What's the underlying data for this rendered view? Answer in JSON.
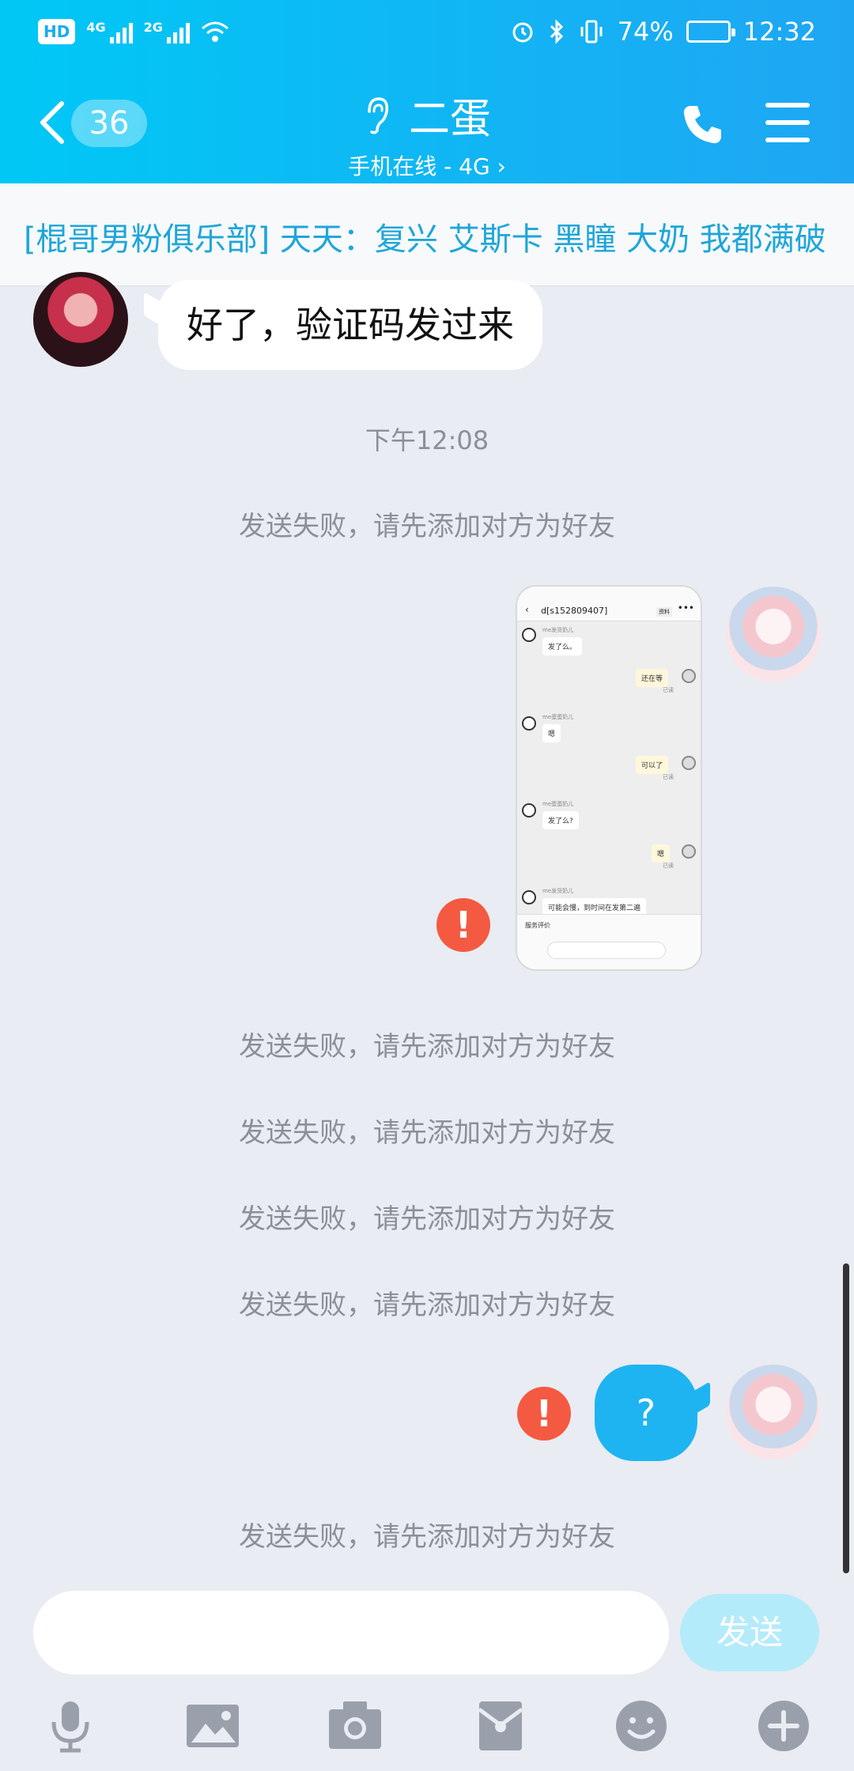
{
  "status_bar": {
    "hd": "HD",
    "sim1_network": "4G",
    "sim2_network": "2G",
    "battery_percent": "74%",
    "battery_level": 0.74,
    "time": "12:32"
  },
  "header": {
    "unread_count": "36",
    "contact_name": "二蛋",
    "status": "手机在线 - 4G",
    "bg_colors": [
      "#00c8f5",
      "#1fa6f3"
    ]
  },
  "ticker": {
    "text": "[棍哥男粉俱乐部] 天天：复兴 艾斯卡 黑瞳 大奶 我都满破"
  },
  "messages": {
    "incoming_text": "好了，验证码发过来",
    "timestamp": "下午12:08",
    "system_notice": "发送失败，请先添加对方为好友",
    "error_mark": "!",
    "outgoing_text": "?"
  },
  "screenshot_thumb": {
    "title": "d[s152809407]",
    "tag": "资料",
    "rows": [
      {
        "sender": "me发货奶儿",
        "text": "发了么。",
        "side": "left"
      },
      {
        "sender": "",
        "text": "还在等",
        "side": "right",
        "note": "已读"
      },
      {
        "sender": "me蛋蛋奶儿",
        "text": "嗯",
        "side": "left"
      },
      {
        "sender": "",
        "text": "可以了",
        "side": "right",
        "note": "已读"
      },
      {
        "sender": "me蛋蛋奶儿",
        "text": "发了么?",
        "side": "left"
      },
      {
        "sender": "",
        "text": "嗯",
        "side": "right",
        "note": "已读"
      },
      {
        "sender": "me发货奶儿",
        "text": "可能会慢，到时间在发第二遍",
        "side": "left"
      }
    ],
    "footer_label": "服务评价"
  },
  "input": {
    "placeholder": "",
    "send_label": "发送"
  },
  "toolbar": {
    "icons": [
      "microphone-icon",
      "image-icon",
      "camera-icon",
      "red-packet-icon",
      "emoji-icon",
      "plus-icon"
    ]
  },
  "colors": {
    "accent": "#1eb4f2",
    "error": "#f45a42",
    "ticker_text": "#1fa6d8",
    "background": "#e9ecf2"
  }
}
